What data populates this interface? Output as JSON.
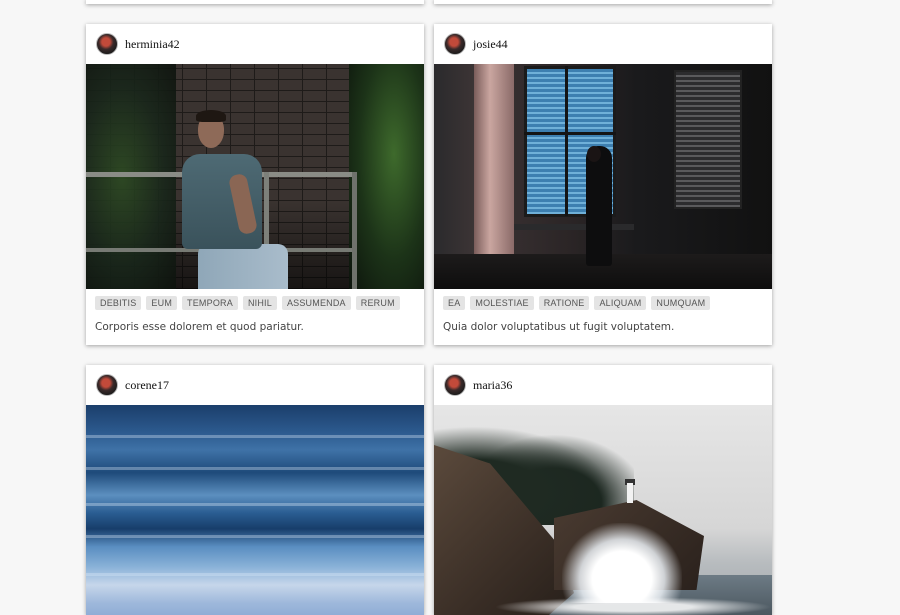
{
  "posts": [
    {
      "username": "herminia42",
      "photo_icon": "portrait-photo",
      "tags": [
        "DEBITIS",
        "EUM",
        "TEMPORA",
        "NIHIL",
        "ASSUMENDA",
        "RERUM"
      ],
      "caption": "Corporis esse dolorem et quod pariatur."
    },
    {
      "username": "josie44",
      "photo_icon": "window-photo",
      "tags": [
        "EA",
        "MOLESTIAE",
        "RATIONE",
        "ALIQUAM",
        "NUMQUAM"
      ],
      "caption": "Quia dolor voluptatibus ut fugit voluptatem."
    },
    {
      "username": "corene17",
      "photo_icon": "ocean-photo"
    },
    {
      "username": "maria36",
      "photo_icon": "lighthouse-photo"
    }
  ]
}
